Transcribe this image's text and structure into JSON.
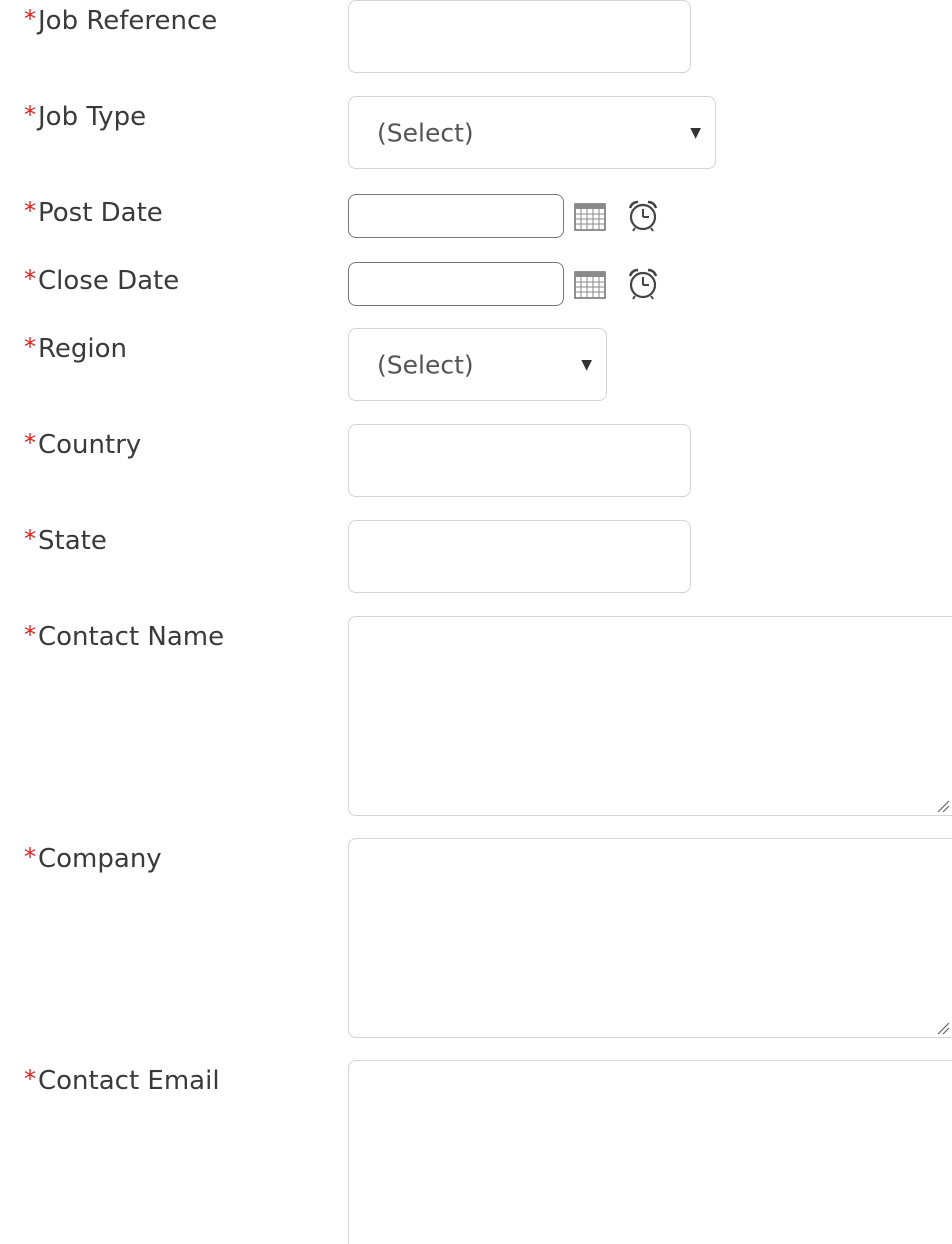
{
  "required_marker": "*",
  "fields": {
    "job_reference": {
      "label": "Job Reference",
      "value": ""
    },
    "job_type": {
      "label": "Job Type",
      "selected": "(Select)"
    },
    "post_date": {
      "label": "Post Date",
      "value": ""
    },
    "close_date": {
      "label": "Close Date",
      "value": ""
    },
    "region": {
      "label": "Region",
      "selected": "(Select)"
    },
    "country": {
      "label": "Country",
      "value": ""
    },
    "state": {
      "label": "State",
      "value": ""
    },
    "contact_name": {
      "label": "Contact Name",
      "value": ""
    },
    "company": {
      "label": "Company",
      "value": ""
    },
    "contact_email": {
      "label": "Contact Email",
      "value": ""
    }
  },
  "icons": {
    "calendar": "calendar-icon",
    "clock": "clock-icon",
    "dropdown": "dropdown-arrow-icon"
  },
  "colors": {
    "required": "#e02020",
    "label": "#3a3a3a",
    "border": "#d4d4d4",
    "date_border": "#777777"
  }
}
